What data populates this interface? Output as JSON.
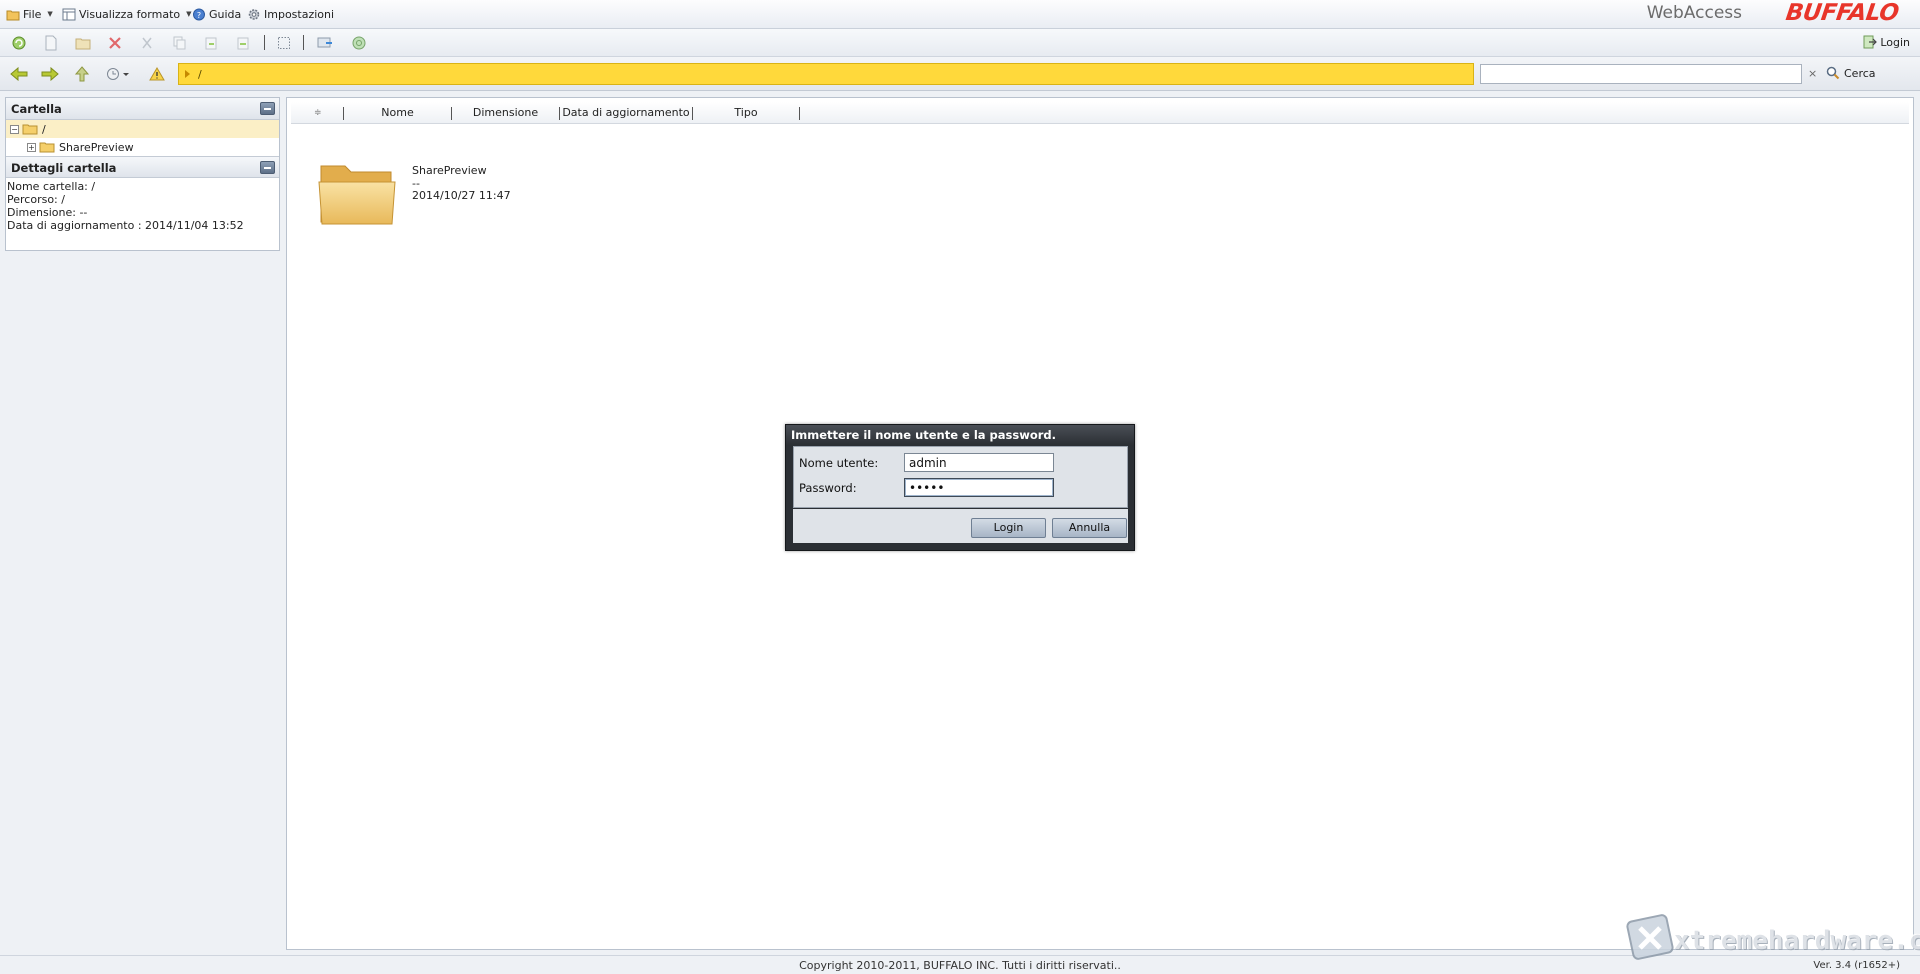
{
  "app": {
    "brand_text": "WebAccess",
    "brand_logo": "BUFFALO"
  },
  "menubar": {
    "file": "File",
    "view_format": "Visualizza formato",
    "help": "Guida",
    "settings": "Impostazioni"
  },
  "toolbar": {
    "login": "Login"
  },
  "navbar": {
    "path": "/",
    "search_value": "",
    "search_clear": "×",
    "search_label": "Cerca"
  },
  "folder_panel": {
    "title": "Cartella",
    "root_label": "/",
    "child_label": "SharePreview"
  },
  "details_panel": {
    "title": "Dettagli cartella",
    "lines": [
      "Nome cartella: /",
      "Percorso: /",
      "Dimensione: --",
      "Data di aggiornamento : 2014/11/04 13:52"
    ]
  },
  "columns": {
    "name": "Nome",
    "size": "Dimensione",
    "updated": "Data di aggiornamento",
    "type": "Tipo"
  },
  "files": [
    {
      "name": "SharePreview",
      "size": "--",
      "date": "2014/10/27 11:47"
    }
  ],
  "dialog": {
    "title": "Immettere il nome utente e la password.",
    "username_label": "Nome utente:",
    "username_value": "admin",
    "password_label": "Password:",
    "password_value": "•••••",
    "login_label": "Login",
    "cancel_label": "Annulla"
  },
  "footer": {
    "copyright": "Copyright 2010-2011, BUFFALO INC. Tutti i diritti riservati..",
    "version": "Ver. 3.4 (r1652+)"
  },
  "watermark": {
    "text": "xtremehardware.com"
  },
  "colors": {
    "path_bar": "#ffd93b",
    "brand_red": "#e8352a",
    "dialog_frame": "#2b2f34"
  }
}
